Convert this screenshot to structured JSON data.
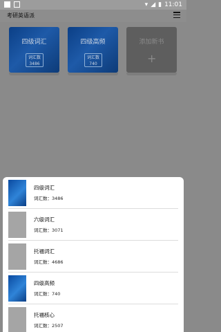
{
  "status_bar": {
    "time": "11:01"
  },
  "header": {
    "title": "考研英语派"
  },
  "tiles": [
    {
      "name": "四级词汇",
      "count_label": "词汇数",
      "count": "3486"
    },
    {
      "name": "四级高频",
      "count_label": "词汇数",
      "count": "740"
    },
    {
      "name": "添加新书"
    }
  ],
  "book_list": [
    {
      "title": "四级词汇",
      "count": "词汇数：3486",
      "cover": "blue"
    },
    {
      "title": "六级词汇",
      "count": "词汇数：3071",
      "cover": "gray"
    },
    {
      "title": "托福词汇",
      "count": "词汇数：4686",
      "cover": "gray"
    },
    {
      "title": "四级高频",
      "count": "词汇数：740",
      "cover": "blue"
    },
    {
      "title": "托福核心",
      "count": "词汇数：2507",
      "cover": "gray"
    }
  ]
}
